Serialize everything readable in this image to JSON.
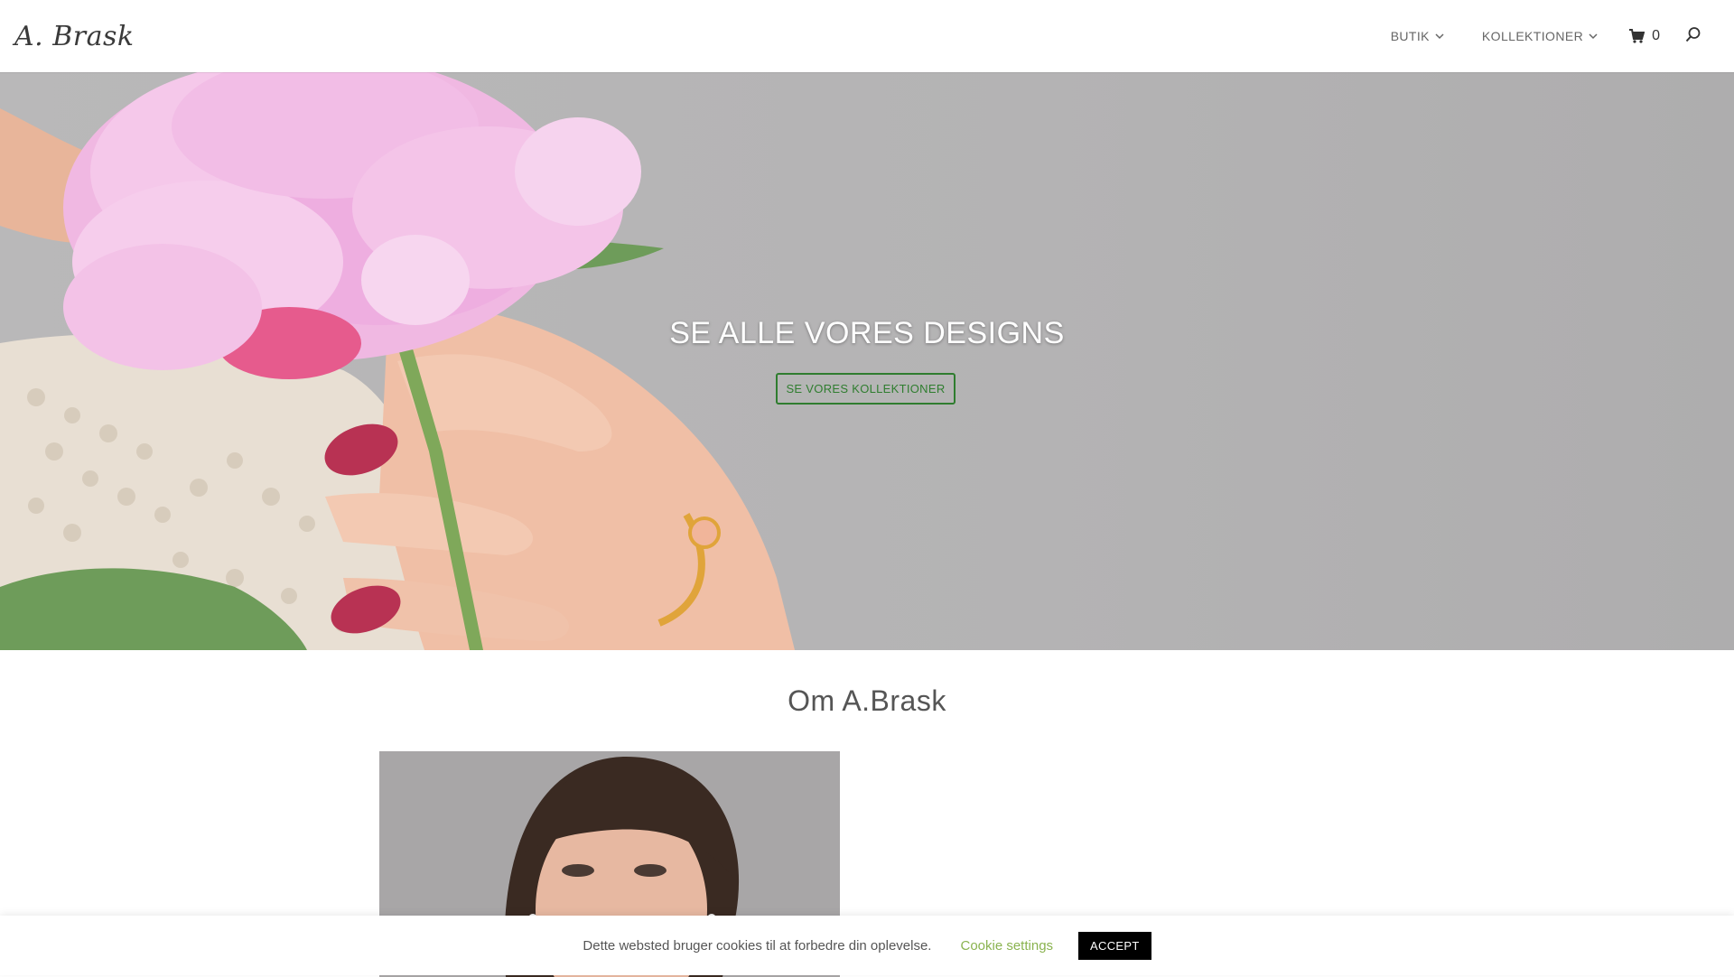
{
  "header": {
    "logo_text": "A. Brask",
    "nav": [
      {
        "label": "BUTIK"
      },
      {
        "label": "KOLLEKTIONER"
      }
    ],
    "cart_count": "0"
  },
  "hero": {
    "title": "SE ALLE VORES DESIGNS",
    "button_label": "SE VORES KOLLEKTIONER"
  },
  "about": {
    "title": "Om A.Brask"
  },
  "cookie_bar": {
    "message": "Dette websted bruger cookies til at forbedre din oplevelse.",
    "settings_label": "Cookie settings",
    "accept_label": "ACCEPT"
  },
  "colors": {
    "accent_green": "#2f7d2f",
    "cookie_link_green": "#8ab34f",
    "hero_background": "#b6b5b6"
  },
  "icons": [
    "chevron-down-icon",
    "cart-icon",
    "search-icon"
  ]
}
